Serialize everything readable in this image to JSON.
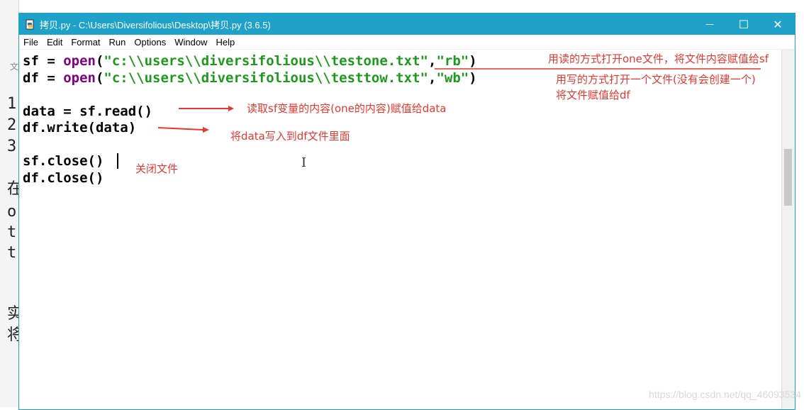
{
  "background_doc": {
    "chars": [
      "文",
      "1",
      "2",
      "3",
      "在",
      "o",
      "t",
      "t",
      "实",
      "将"
    ]
  },
  "window": {
    "title": "拷贝.py - C:\\Users\\Diversifolious\\Desktop\\拷贝.py (3.6.5)",
    "controls": {
      "minimize": "—",
      "maximize": "☐",
      "close": "✕"
    }
  },
  "menu": [
    "File",
    "Edit",
    "Format",
    "Run",
    "Options",
    "Window",
    "Help"
  ],
  "code": {
    "line1": {
      "pre": "sf = ",
      "kw": "open",
      "open": "(",
      "s1": "\"c:\\\\users\\\\diversifolious\\\\testone.txt\"",
      "comma": ",",
      "s2": "\"rb\"",
      "close": ")"
    },
    "line2": {
      "pre": "df = ",
      "kw": "open",
      "open": "(",
      "s1": "\"c:\\\\users\\\\diversifolious\\\\testtow.txt\"",
      "comma": ",",
      "s2": "\"wb\"",
      "close": ")"
    },
    "line3": "data = sf.read()",
    "line4": "df.write(data)",
    "line5": "sf.close()",
    "line6": "df.close()"
  },
  "annotations": {
    "a1": "用读的方式打开one文件，将文件内容赋值给sf",
    "a2_1": "用写的方式打开一个文件(没有会创建一个)",
    "a2_2": "将文件赋值给df",
    "a3": "读取sf变量的内容(one的内容)赋值给data",
    "a4": "将data写入到df文件里面",
    "a5": "关闭文件"
  },
  "colors": {
    "titlebar": "#1ea2c9",
    "keyword": "#800080",
    "string": "#1d9a1d",
    "annotation": "#e8372f"
  },
  "watermark": "https://blog.csdn.net/qq_46093534"
}
